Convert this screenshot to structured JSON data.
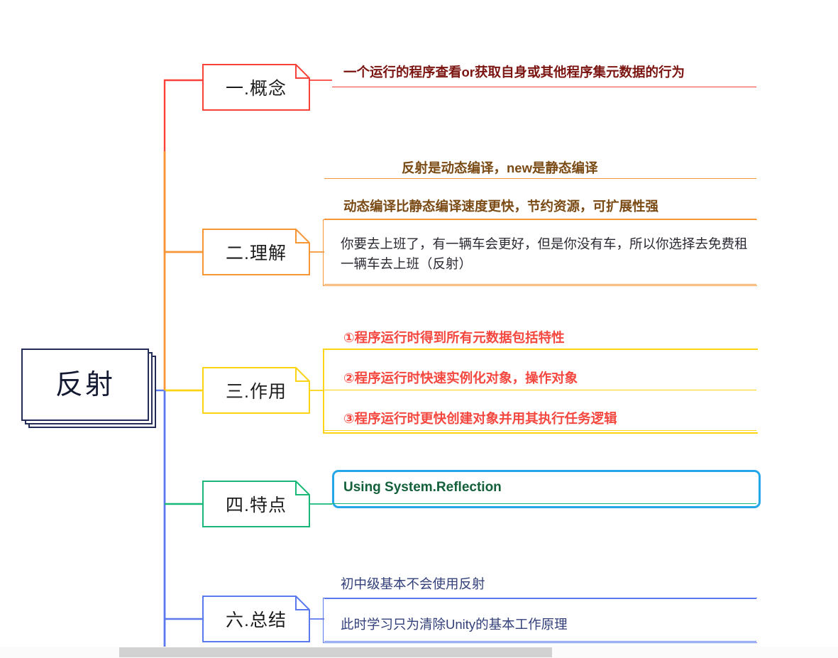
{
  "root": {
    "label": "反射"
  },
  "colors": {
    "branch1": "#f9423a",
    "branch2": "#f79637",
    "branch3": "#fbd416",
    "branch4": "#18b879",
    "branch6": "#5a79ee",
    "root_border": "#232c57",
    "maroon_text": "#7b1512",
    "brown_text": "#7a4a15",
    "red_text": "#f4473f",
    "green_text": "#13603b",
    "blue_text": "#33407a",
    "cyan_box": "#23a7e8",
    "scrollbar_thumb": "#d2d2d2"
  },
  "branches": [
    {
      "id": "gainian",
      "label": "一.概念",
      "color": "#f9423a",
      "items": [
        {
          "text": "一个运行的程序查看or获取自身或其他程序集元数据的行为",
          "style": "bold-maroon"
        }
      ]
    },
    {
      "id": "lijie",
      "label": "二.理解",
      "color": "#f79637",
      "items": [
        {
          "text": "反射是动态编译，new是静态编译",
          "style": "bold-brown"
        },
        {
          "text": "动态编译比静态编译速度更快，节约资源，可扩展性强",
          "style": "bold-brown"
        },
        {
          "text": "你要去上班了，有一辆车会更好，但是你没有车，所以你选择去免费租一辆车去上班（反射）",
          "style": "plain"
        }
      ]
    },
    {
      "id": "zuoyong",
      "label": "三.作用",
      "color": "#fbd416",
      "items": [
        {
          "text": "①程序运行时得到所有元数据包括特性",
          "style": "bold-red"
        },
        {
          "text": "②程序运行时快速实例化对象，操作对象",
          "style": "bold-red"
        },
        {
          "text": "③程序运行时更快创建对象并用其执行任务逻辑",
          "style": "bold-red"
        }
      ]
    },
    {
      "id": "tedian",
      "label": "四.特点",
      "color": "#18b879",
      "items": [
        {
          "text": "Using System.Reflection",
          "style": "bold-green"
        }
      ]
    },
    {
      "id": "zongjie",
      "label": "六.总结",
      "color": "#5a79ee",
      "items": [
        {
          "text": "初中级基本不会使用反射",
          "style": "blue-plain"
        },
        {
          "text": "此时学习只为清除Unity的基本工作原理",
          "style": "blue-plain"
        }
      ]
    }
  ],
  "scrollbar": {
    "orientation": "horizontal"
  }
}
